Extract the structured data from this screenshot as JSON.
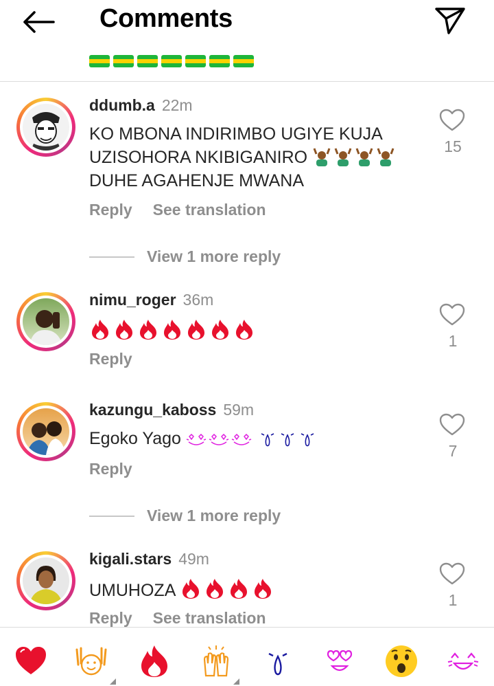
{
  "header": {
    "title": "Comments",
    "back_icon": "arrow-left-icon",
    "send_icon": "paper-plane-icon"
  },
  "colors": {
    "flag_green": "#1eb53a",
    "flag_yellow": "#fad201",
    "heart_red": "#e8112d",
    "fire_red": "#e8112d",
    "muted": "#8e8e8e"
  },
  "comments": [
    {
      "username": "ddumb.a",
      "time": "22m",
      "text": "KO MBONA INDIRIMBO UGIYE KUJA UZISOHORA NKIBIGANIRO 🙆🏽‍♂️🙆🏽‍♂️🙆🏽‍♂️🙆🏽‍♂️ DUHE AGAHENJE MWANA",
      "text_line1": "KO MBONA INDIRIMBO UGIYE KUJA",
      "text_line2": "UZISOHORA NKIBIGANIRO",
      "text_line3": "DUHE AGAHENJE MWANA",
      "reply": "Reply",
      "see_translation": "See translation",
      "likes": "15",
      "view_more": "View 1 more reply"
    },
    {
      "username": "nimu_roger",
      "time": "36m",
      "text": "🔥🔥🔥🔥🔥🔥🔥",
      "reply": "Reply",
      "likes": "1"
    },
    {
      "username": "kazungu_kaboss",
      "time": "59m",
      "text_prefix": "Egoko Yago",
      "text": "Egoko Yago 😍😍😍😢😢😢",
      "reply": "Reply",
      "likes": "7",
      "view_more": "View 1 more reply"
    },
    {
      "username": "kigali.stars",
      "time": "49m",
      "text_prefix": "UMUHOZA",
      "text": "UMUHOZA 🔥🔥🔥🔥",
      "reply": "Reply",
      "see_translation": "See translation",
      "likes": "1"
    }
  ],
  "reactions": [
    {
      "icon": "red-heart-emoji-icon"
    },
    {
      "icon": "raising-hands-emoji-icon"
    },
    {
      "icon": "fire-emoji-icon"
    },
    {
      "icon": "clapping-hands-emoji-icon"
    },
    {
      "icon": "crying-face-emoji-icon"
    },
    {
      "icon": "heart-eyes-emoji-icon"
    },
    {
      "icon": "surprised-face-emoji-icon"
    },
    {
      "icon": "laughing-face-emoji-icon"
    }
  ]
}
